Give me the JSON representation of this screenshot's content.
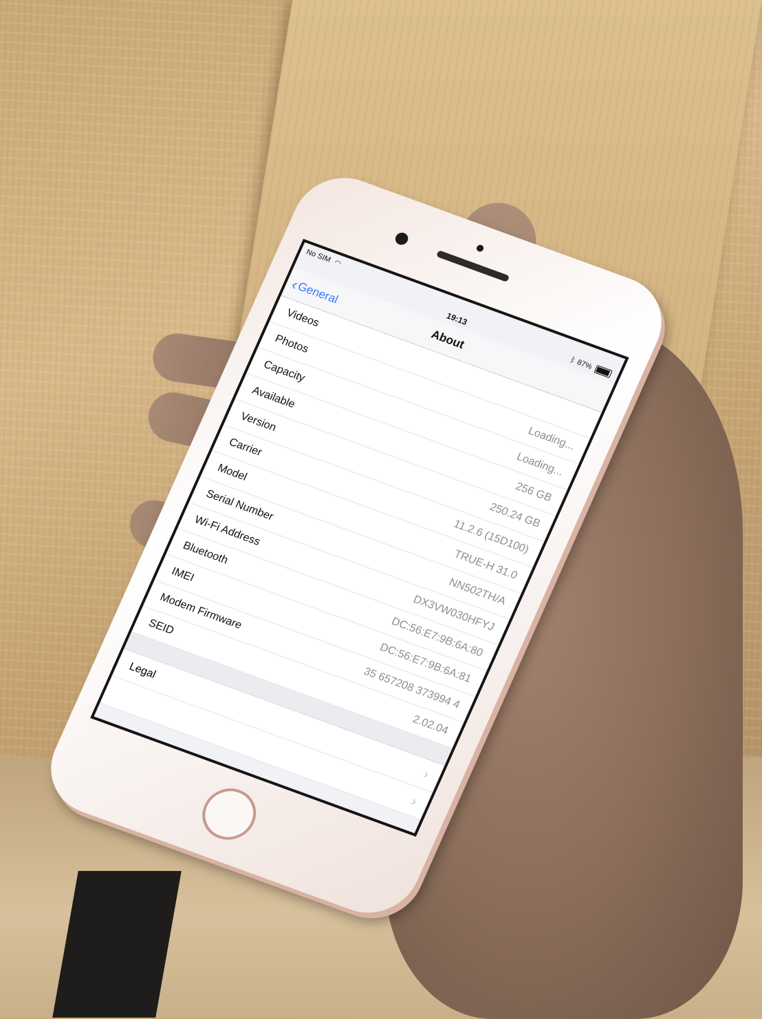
{
  "status_bar": {
    "carrier": "No SIM",
    "time": "19:13",
    "battery_percent": "87%",
    "battery_level": 0.87
  },
  "nav": {
    "back_label": "General",
    "title": "About"
  },
  "rows": [
    {
      "label": "Videos",
      "value": ""
    },
    {
      "label": "Photos",
      "value": "Loading..."
    },
    {
      "label": "Capacity",
      "value": "Loading..."
    },
    {
      "label": "Available",
      "value": "256 GB"
    },
    {
      "label": "Version",
      "value": "250.24 GB"
    },
    {
      "label": "Carrier",
      "value": "11.2.6 (15D100)"
    },
    {
      "label": "Model",
      "value": "TRUE-H 31.0"
    },
    {
      "label": "Serial Number",
      "value": "NN502TH/A"
    },
    {
      "label": "Wi-Fi Address",
      "value": "DX3VW030HFYJ"
    },
    {
      "label": "Bluetooth",
      "value": "DC:56:E7:9B:6A:80"
    },
    {
      "label": "IMEI",
      "value": "DC:56:E7:9B:6A:81"
    },
    {
      "label": "Modem Firmware",
      "value": "35 657208 373994 4"
    },
    {
      "label": "SEID",
      "value": "2.02.04"
    }
  ],
  "legal": {
    "label": "Legal"
  },
  "icons": {
    "wifi": "wifi-icon",
    "bluetooth": "bluetooth-icon",
    "battery": "battery-icon",
    "back": "chevron-left-icon",
    "disclosure": "chevron-right-icon"
  },
  "colors": {
    "ios_blue": "#2f7bf6",
    "phone_rose_gold": "#d9b2a3"
  }
}
